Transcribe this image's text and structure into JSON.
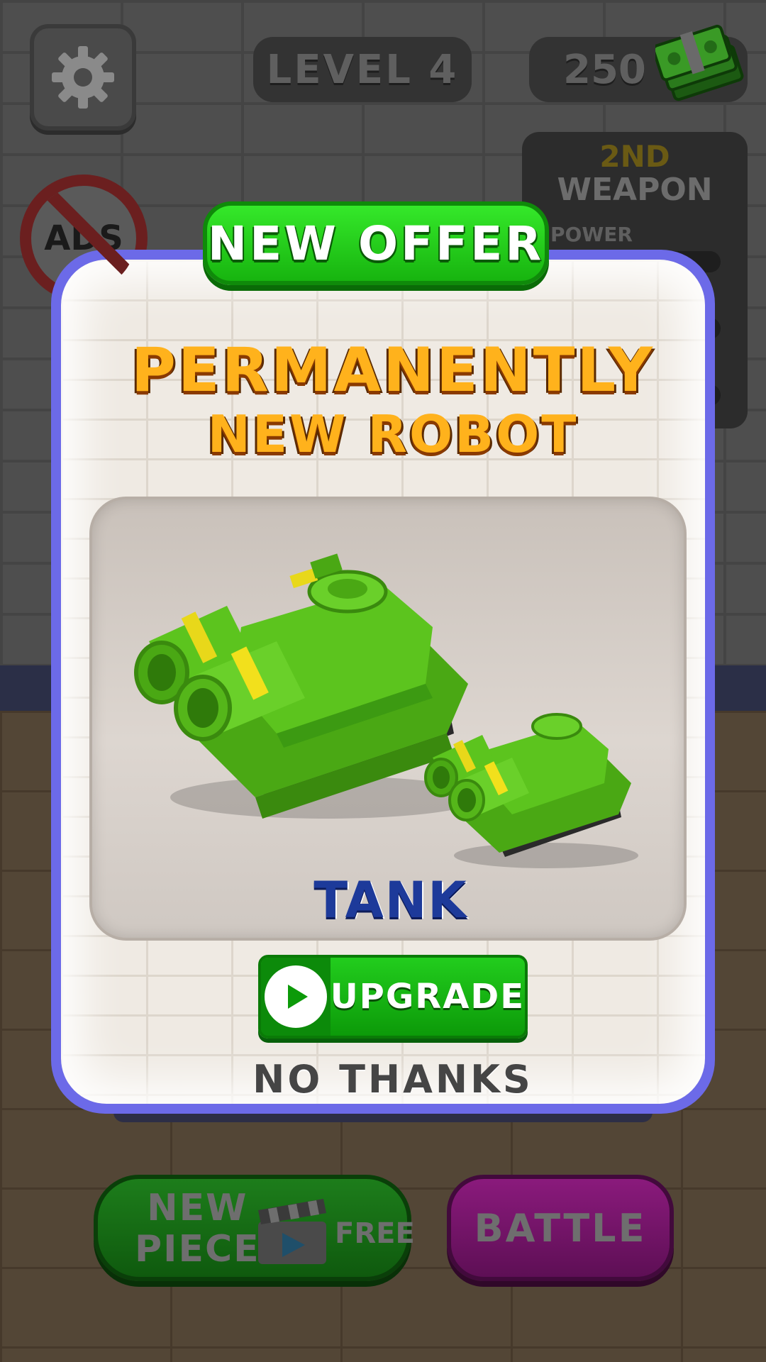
{
  "hud": {
    "level_label": "LEVEL 4",
    "cash_amount": "250",
    "settings_icon": "gear-icon",
    "cash_icon": "cash-stack-icon",
    "no_ads_label": "ADS"
  },
  "weapon_panel": {
    "tier": "2ND",
    "name": "WEAPON",
    "stat_label": "POWER"
  },
  "offer": {
    "banner": "NEW OFFER",
    "headline_1": "PERMANENTLY",
    "headline_2": "NEW ROBOT",
    "robot_name": "TANK",
    "upgrade_label": "UPGRADE",
    "upgrade_icon": "play-icon",
    "decline_label": "NO THANKS"
  },
  "bottom": {
    "new_piece_line_1": "NEW",
    "new_piece_line_2": "PIECE",
    "new_piece_free": "FREE",
    "new_piece_icon": "clapperboard-icon",
    "battle_label": "BATTLE"
  },
  "colors": {
    "modal_border": "#6c6ae8",
    "headline": "#ffb21c",
    "robot_name": "#1d3a9a",
    "green_button": "#17b40f",
    "battle_button": "#5e0f55"
  }
}
